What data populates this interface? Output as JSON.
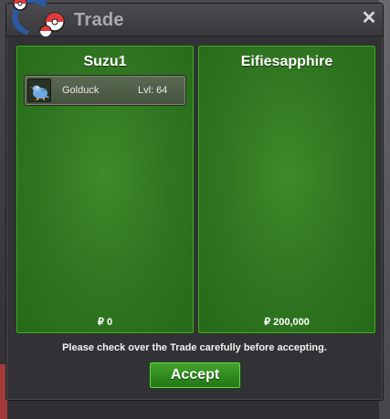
{
  "window": {
    "title": "Trade",
    "close_label": "✕"
  },
  "icons": {
    "logo": "pokeball-logo-icon",
    "close": "close-icon",
    "item": "pokemon-sprite-icon"
  },
  "left_panel": {
    "player": "Suzu1",
    "items": [
      {
        "name": "Golduck",
        "level": "Lvl: 64"
      }
    ],
    "money": "₽ 0"
  },
  "right_panel": {
    "player": "Eifiesapphire",
    "items": [],
    "money": "₽ 200,000"
  },
  "notice": "Please check over the Trade carefully before accepting.",
  "accept_label": "Accept",
  "colors": {
    "panel_green": "#2f7420",
    "button_green": "#2e8a1c",
    "window_dark": "#323236",
    "title_gray": "#a9a9ae"
  }
}
